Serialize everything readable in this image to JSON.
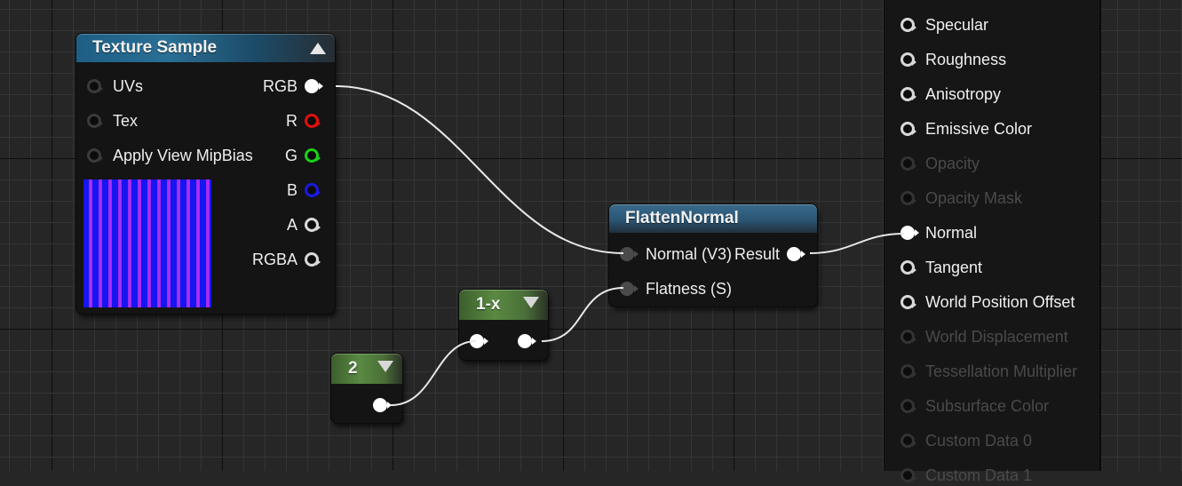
{
  "graph": {
    "background_color": "#262626"
  },
  "nodes": {
    "texture_sample": {
      "title": "Texture Sample",
      "header_color": "#1e5e85",
      "inputs": [
        {
          "label": "UVs",
          "connected": false
        },
        {
          "label": "Tex",
          "connected": false
        },
        {
          "label": "Apply View MipBias",
          "connected": false
        }
      ],
      "outputs": [
        {
          "label": "RGB",
          "color": "#ffffff",
          "connected": true
        },
        {
          "label": "R",
          "color": "#e01010",
          "connected": false
        },
        {
          "label": "G",
          "color": "#18d018",
          "connected": false
        },
        {
          "label": "B",
          "color": "#1a1ae0",
          "connected": false
        },
        {
          "label": "A",
          "color": "#d8d8d8",
          "connected": false
        },
        {
          "label": "RGBA",
          "color": "#d8d8d8",
          "connected": false
        }
      ],
      "preview": "normal-map-stripes"
    },
    "flatten_normal": {
      "title": "FlattenNormal",
      "inputs": [
        {
          "label": "Normal (V3)",
          "connected": true
        },
        {
          "label": "Flatness (S)",
          "connected": true
        }
      ],
      "outputs": [
        {
          "label": "Result",
          "connected": true
        }
      ]
    },
    "one_minus": {
      "title": "1-x",
      "header_color": "#5a8a42"
    },
    "constant": {
      "title": "2",
      "header_color": "#5a8a42"
    }
  },
  "material_panel": {
    "pins": [
      {
        "label": "Specular",
        "enabled": true,
        "connected": false
      },
      {
        "label": "Roughness",
        "enabled": true,
        "connected": false
      },
      {
        "label": "Anisotropy",
        "enabled": true,
        "connected": false
      },
      {
        "label": "Emissive Color",
        "enabled": true,
        "connected": false
      },
      {
        "label": "Opacity",
        "enabled": false,
        "connected": false
      },
      {
        "label": "Opacity Mask",
        "enabled": false,
        "connected": false
      },
      {
        "label": "Normal",
        "enabled": true,
        "connected": true
      },
      {
        "label": "Tangent",
        "enabled": true,
        "connected": false
      },
      {
        "label": "World Position Offset",
        "enabled": true,
        "connected": false
      },
      {
        "label": "World Displacement",
        "enabled": false,
        "connected": false
      },
      {
        "label": "Tessellation Multiplier",
        "enabled": false,
        "connected": false
      },
      {
        "label": "Subsurface Color",
        "enabled": false,
        "connected": false
      },
      {
        "label": "Custom Data 0",
        "enabled": false,
        "connected": false
      },
      {
        "label": "Custom Data 1",
        "enabled": false,
        "connected": false
      }
    ]
  },
  "connections": [
    {
      "from": "texture_sample.RGB",
      "to": "flatten_normal.Normal (V3)"
    },
    {
      "from": "constant.output",
      "to": "one_minus.input"
    },
    {
      "from": "one_minus.output",
      "to": "flatten_normal.Flatness (S)"
    },
    {
      "from": "flatten_normal.Result",
      "to": "material_panel.Normal"
    }
  ]
}
